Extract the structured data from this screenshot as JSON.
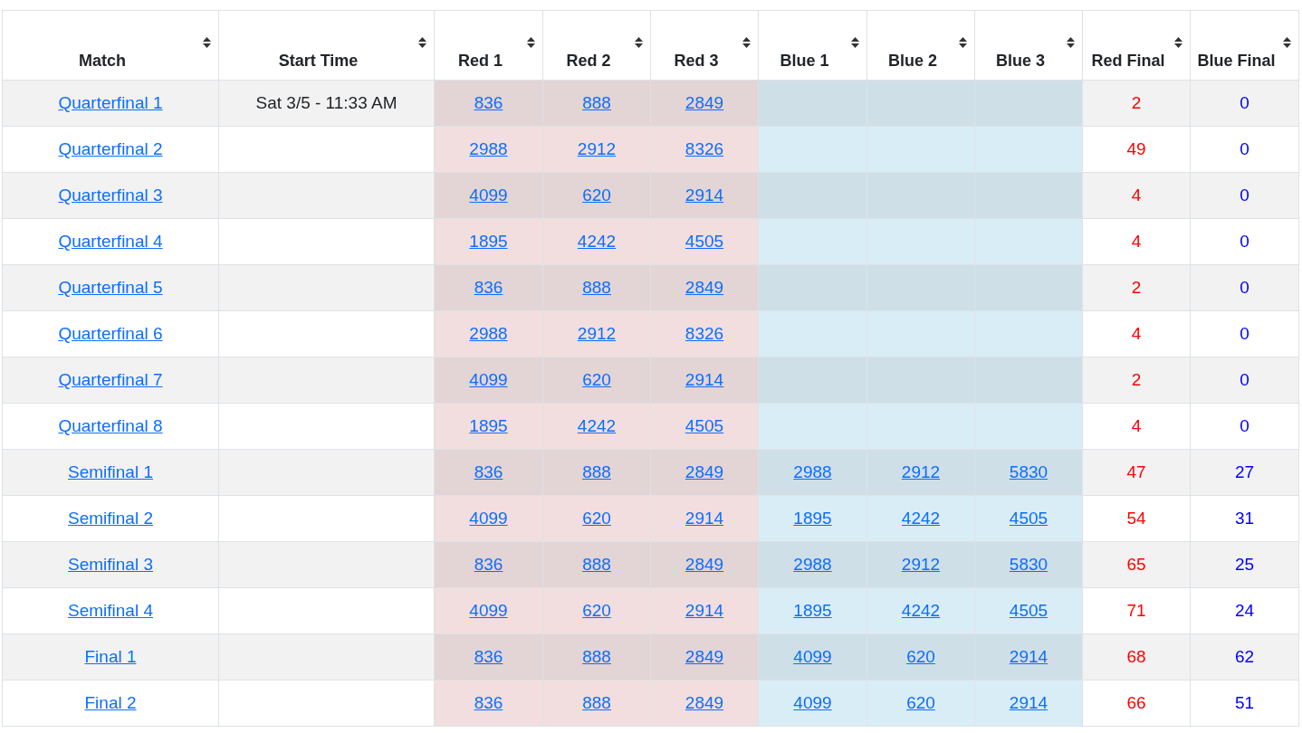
{
  "table": {
    "columns": [
      "Match",
      "Start Time",
      "Red 1",
      "Red 2",
      "Red 3",
      "Blue 1",
      "Blue 2",
      "Blue 3",
      "Red Final",
      "Blue Final"
    ],
    "rows": [
      {
        "match": "Quarterfinal 1",
        "start_time": "Sat 3/5 - 11:33 AM",
        "red": [
          "836",
          "888",
          "2849"
        ],
        "red_final": "2",
        "blue_final": "0"
      },
      {
        "match": "Quarterfinal 2",
        "red": [
          "2988",
          "2912",
          "8326"
        ],
        "red_final": "49",
        "blue_final": "0"
      },
      {
        "match": "Quarterfinal 3",
        "red": [
          "4099",
          "620",
          "2914"
        ],
        "red_final": "4",
        "blue_final": "0"
      },
      {
        "match": "Quarterfinal 4",
        "red": [
          "1895",
          "4242",
          "4505"
        ],
        "red_final": "4",
        "blue_final": "0"
      },
      {
        "match": "Quarterfinal 5",
        "red": [
          "836",
          "888",
          "2849"
        ],
        "red_final": "2",
        "blue_final": "0"
      },
      {
        "match": "Quarterfinal 6",
        "red": [
          "2988",
          "2912",
          "8326"
        ],
        "red_final": "4",
        "blue_final": "0"
      },
      {
        "match": "Quarterfinal 7",
        "red": [
          "4099",
          "620",
          "2914"
        ],
        "red_final": "2",
        "blue_final": "0"
      },
      {
        "match": "Quarterfinal 8",
        "red": [
          "1895",
          "4242",
          "4505"
        ],
        "red_final": "4",
        "blue_final": "0"
      },
      {
        "match": "Semifinal 1",
        "red": [
          "836",
          "888",
          "2849"
        ],
        "blue": [
          "2988",
          "2912",
          "5830"
        ],
        "red_final": "47",
        "blue_final": "27"
      },
      {
        "match": "Semifinal 2",
        "red": [
          "4099",
          "620",
          "2914"
        ],
        "blue": [
          "1895",
          "4242",
          "4505"
        ],
        "red_final": "54",
        "blue_final": "31"
      },
      {
        "match": "Semifinal 3",
        "red": [
          "836",
          "888",
          "2849"
        ],
        "blue": [
          "2988",
          "2912",
          "5830"
        ],
        "red_final": "65",
        "blue_final": "25"
      },
      {
        "match": "Semifinal 4",
        "red": [
          "4099",
          "620",
          "2914"
        ],
        "blue": [
          "1895",
          "4242",
          "4505"
        ],
        "red_final": "71",
        "blue_final": "24"
      },
      {
        "match": "Final 1",
        "red": [
          "836",
          "888",
          "2849"
        ],
        "blue": [
          "4099",
          "620",
          "2914"
        ],
        "red_final": "68",
        "blue_final": "62"
      },
      {
        "match": "Final 2",
        "red": [
          "836",
          "888",
          "2849"
        ],
        "blue": [
          "4099",
          "620",
          "2914"
        ],
        "red_final": "66",
        "blue_final": "51"
      }
    ]
  }
}
